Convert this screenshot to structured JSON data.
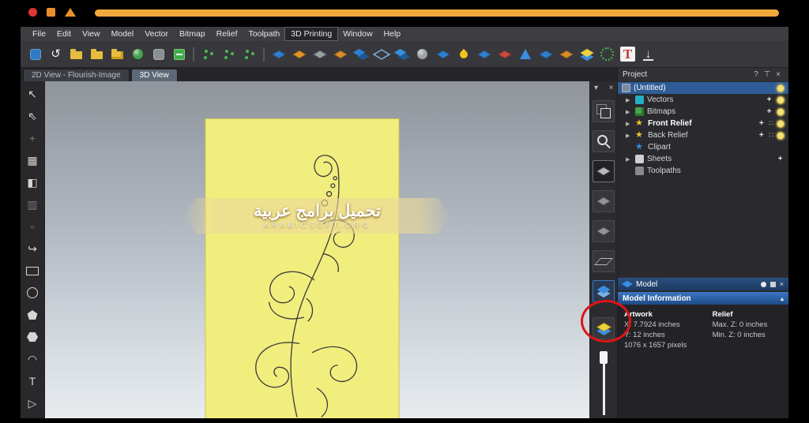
{
  "window": {
    "controls": [
      "record-dot",
      "orange-square",
      "orange-triangle"
    ],
    "progress_color": "#f2a93b"
  },
  "menu": {
    "items": [
      {
        "name": "menu-file",
        "label": "File"
      },
      {
        "name": "menu-edit",
        "label": "Edit"
      },
      {
        "name": "menu-view",
        "label": "View"
      },
      {
        "name": "menu-model",
        "label": "Model"
      },
      {
        "name": "menu-vector",
        "label": "Vector"
      },
      {
        "name": "menu-bitmap",
        "label": "Bitmap"
      },
      {
        "name": "menu-relief",
        "label": "Relief"
      },
      {
        "name": "menu-toolpath",
        "label": "Toolpath"
      },
      {
        "name": "menu-3d-printing",
        "label": "3D Printing",
        "cls": "active"
      },
      {
        "name": "menu-window",
        "label": "Window"
      },
      {
        "name": "menu-help",
        "label": "Help"
      }
    ]
  },
  "toolbar": {
    "icons": [
      {
        "name": "save-icon",
        "cls": "tb-sq",
        "color": "#2e7bc4"
      },
      {
        "name": "undo-icon",
        "cls": "tb-glyph",
        "glyph": "↺"
      },
      {
        "name": "open-folder-icon",
        "cls": "tb-folder"
      },
      {
        "name": "import-folder-icon",
        "cls": "tb-folder"
      },
      {
        "name": "export-folder-icon",
        "cls": "tb-folder tb-folder-star"
      },
      {
        "name": "material-sphere-icon",
        "cls": "tb-sphere",
        "color": "#45a049"
      },
      {
        "name": "panel-icon",
        "cls": "tb-sq",
        "color": "#8a8f94"
      },
      {
        "name": "add-model-icon",
        "cls": "tb-plus"
      },
      {
        "name": "separator",
        "cls": "tb-sep",
        "inter": false
      },
      {
        "name": "scatter-points-icon",
        "cls": "tb-dots"
      },
      {
        "name": "grid-points-icon",
        "cls": "tb-dots"
      },
      {
        "name": "connect-points-icon",
        "cls": "tb-dots"
      },
      {
        "name": "separator",
        "cls": "tb-sep",
        "inter": false
      },
      {
        "name": "relief-blue-icon",
        "cls": "tb-d",
        "color": "#2f7fd0"
      },
      {
        "name": "relief-orange-icon",
        "cls": "tb-d",
        "color": "#e09422"
      },
      {
        "name": "relief-gray-icon",
        "cls": "tb-d",
        "color": "#9aa0a6"
      },
      {
        "name": "relief-honeycomb-icon",
        "cls": "tb-d tb-hc",
        "color": "#d98b2e"
      },
      {
        "name": "relief-stack-icon",
        "cls": "tb-d2",
        "color": "#2f7fd0"
      },
      {
        "name": "relief-outline-icon",
        "cls": "tb-outline tb-d",
        "color": "#7fb3e0"
      },
      {
        "name": "relief-pair-icon",
        "cls": "tb-d2",
        "color": "#3b8de0"
      },
      {
        "name": "sphere-arrows-icon",
        "cls": "tb-sphere",
        "color": "#9aa0a6"
      },
      {
        "name": "relief-swirl-icon",
        "cls": "tb-d",
        "color": "#2f7fd0"
      },
      {
        "name": "droplet-icon",
        "cls": "tb-drop"
      },
      {
        "name": "relief-small-icon",
        "cls": "tb-d",
        "color": "#2f7fd0"
      },
      {
        "name": "relief-red-icon",
        "cls": "tb-d",
        "color": "#c84a3a"
      },
      {
        "name": "cone-icon",
        "cls": "tb-cone",
        "color": "#3b8de0"
      },
      {
        "name": "relief-blue2-icon",
        "cls": "tb-d",
        "color": "#2f7fd0"
      },
      {
        "name": "honeycomb2-icon",
        "cls": "tb-d tb-hc",
        "color": "#d98b2e"
      },
      {
        "name": "relief-yellow-blue-icon",
        "cls": "tb-dyb"
      },
      {
        "name": "dots-circle-icon",
        "cls": "tb-ring"
      },
      {
        "name": "text-red-icon",
        "cls": "tb-T",
        "glyph": "T"
      },
      {
        "name": "download-icon",
        "cls": "tb-dl",
        "glyph": "↓"
      }
    ]
  },
  "tabs": {
    "items": [
      {
        "name": "tab-2d-view",
        "label": "2D View - Flourish-Image"
      },
      {
        "name": "tab-3d-view",
        "label": "3D View",
        "cls": "active"
      }
    ]
  },
  "left_toolbar": {
    "icons": [
      {
        "name": "select-tool-icon",
        "glyph": "↖"
      },
      {
        "name": "node-edit-tool-icon",
        "glyph": "⇖"
      },
      {
        "name": "transform-tool-icon",
        "glyph": "+",
        "cls": "dim"
      },
      {
        "name": "mesh-tool-icon",
        "glyph": "▦"
      },
      {
        "name": "shading-tool-icon",
        "glyph": "◧"
      },
      {
        "name": "pages-tool-icon",
        "glyph": "▥",
        "cls": "dim"
      },
      {
        "name": "swatch-tool-icon",
        "glyph": "▫",
        "cls": "dim"
      },
      {
        "name": "draw-curve-tool-icon",
        "glyph": "↪"
      },
      {
        "name": "rectangle-tool-icon",
        "cls": "sh-rect"
      },
      {
        "name": "circle-tool-icon",
        "cls": "sh-circle"
      },
      {
        "name": "pentagon-tool-icon",
        "cls": "sh-pent"
      },
      {
        "name": "polygon-tool-icon",
        "cls": "sh-hex"
      },
      {
        "name": "arc-tool-icon",
        "glyph": "◠"
      },
      {
        "name": "text-tool-icon",
        "glyph": "T"
      },
      {
        "name": "polyline-tool-icon",
        "glyph": "▷"
      }
    ]
  },
  "right_strip": {
    "collapse_glyph": "▾",
    "close_glyph": "×",
    "icons": [
      {
        "name": "iso-view-cube-icon",
        "cls": "ri-cube"
      },
      {
        "name": "zoom-tool-icon",
        "cls": "ri-zoom"
      },
      {
        "name": "relief-view-icon",
        "cls": "ri-diamond ri-active",
        "color": "#b8b8b8"
      },
      {
        "name": "front-relief-view-icon",
        "cls": "ri-diamond",
        "color": "#8f949a"
      },
      {
        "name": "back-relief-view-icon",
        "cls": "ri-diamond",
        "color": "#8f949a"
      },
      {
        "name": "plane-view-icon",
        "cls": "ri-plane"
      },
      {
        "name": "layers-view-icon",
        "cls": "ri-layers"
      },
      {
        "name": "preview-relief-icon",
        "cls": "ri-preview"
      }
    ]
  },
  "project": {
    "title": "Project",
    "glyphs": {
      "help": "?",
      "pin": "⊤",
      "close": "×",
      "expander": "▶",
      "plus": "+",
      "dots": "∷"
    },
    "root": "(Untitled)",
    "items": [
      {
        "label": "Vectors"
      },
      {
        "label": "Bitmaps"
      },
      {
        "label": "Front Relief"
      },
      {
        "label": "Back Relief"
      },
      {
        "label": "Clipart"
      },
      {
        "label": "Sheets"
      },
      {
        "label": "Toolpaths"
      }
    ]
  },
  "model_bar": {
    "label": "Model"
  },
  "model_info": {
    "title": "Model Information",
    "collapse_glyph": "▴",
    "artwork_title": "Artwork",
    "artwork_x": "X: 7.7924 inches",
    "artwork_y": "Y: 12 inches",
    "artwork_px": "1076 x 1657 pixels",
    "relief_title": "Relief",
    "relief_max": "Max. Z: 0 inches",
    "relief_min": "Min. Z: 0 inches"
  },
  "watermark": {
    "line1": "تحميل برامج عربية",
    "line2": "ARABICSOFT.ORG"
  }
}
